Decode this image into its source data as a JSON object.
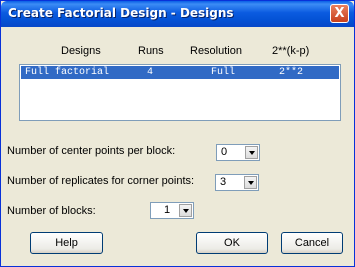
{
  "window": {
    "title": "Create Factorial Design - Designs",
    "close_glyph": "X"
  },
  "table": {
    "headers": [
      "Designs",
      "Runs",
      "Resolution",
      "2**(k-p)"
    ],
    "rows": [
      {
        "design": "Full factorial",
        "runs": "4",
        "resolution": "Full",
        "fraction": "2**2"
      }
    ]
  },
  "fields": {
    "center_points": {
      "label": "Number of center points per block:",
      "value": "0"
    },
    "replicates": {
      "label": "Number of replicates for corner points:",
      "value": "3"
    },
    "blocks": {
      "label": "Number of blocks:",
      "value": "1"
    }
  },
  "buttons": {
    "help": "Help",
    "ok": "OK",
    "cancel": "Cancel"
  },
  "colors": {
    "selection": "#316AC5",
    "titlebar": "#0A5FE6",
    "dialog_bg": "#ECE9D8"
  }
}
